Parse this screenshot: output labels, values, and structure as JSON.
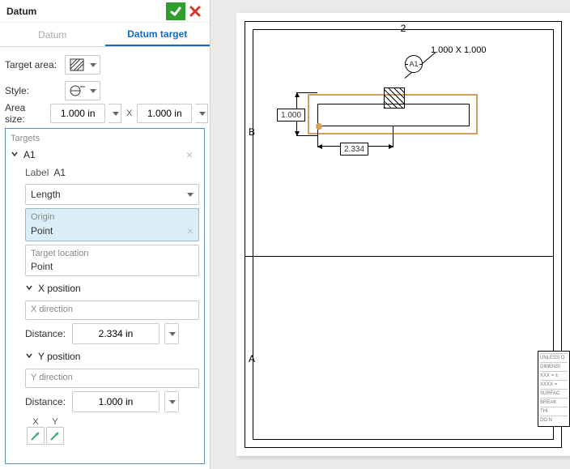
{
  "panel": {
    "title": "Datum",
    "tabs": {
      "inactive": "Datum",
      "active": "Datum target"
    },
    "target_area_label": "Target area:",
    "style_label": "Style:",
    "area_size_label": "Area size:",
    "area_w": "1.000 in",
    "area_h": "1.000 in",
    "x_separator": "X"
  },
  "targets": {
    "header": "Targets",
    "item_name": "A1",
    "label_key": "Label",
    "label_val": "A1",
    "length_select": "Length",
    "origin": {
      "caption": "Origin",
      "value": "Point"
    },
    "target_location": {
      "caption": "Target location",
      "value": "Point"
    },
    "x_position_header": "X position",
    "x_direction_placeholder": "X direction",
    "y_position_header": "Y position",
    "y_direction_placeholder": "Y direction",
    "distance_label": "Distance:",
    "x_distance": "2.334 in",
    "y_distance": "1.000 in",
    "x_col": "X",
    "y_col": "Y"
  },
  "drawing": {
    "zone_top": "2",
    "zone_left_upper": "B",
    "zone_left_lower": "A",
    "callout_text": "1.000 X 1.000",
    "datum_id": "A1",
    "vdim": "1.000",
    "hdim": "2.334",
    "titleblock_lines": [
      "UNLESS O",
      "DIMENSI",
      "XXX = ±",
      "XXXX =",
      "SURFAC",
      "BREAK",
      "THI",
      "DO N"
    ]
  }
}
